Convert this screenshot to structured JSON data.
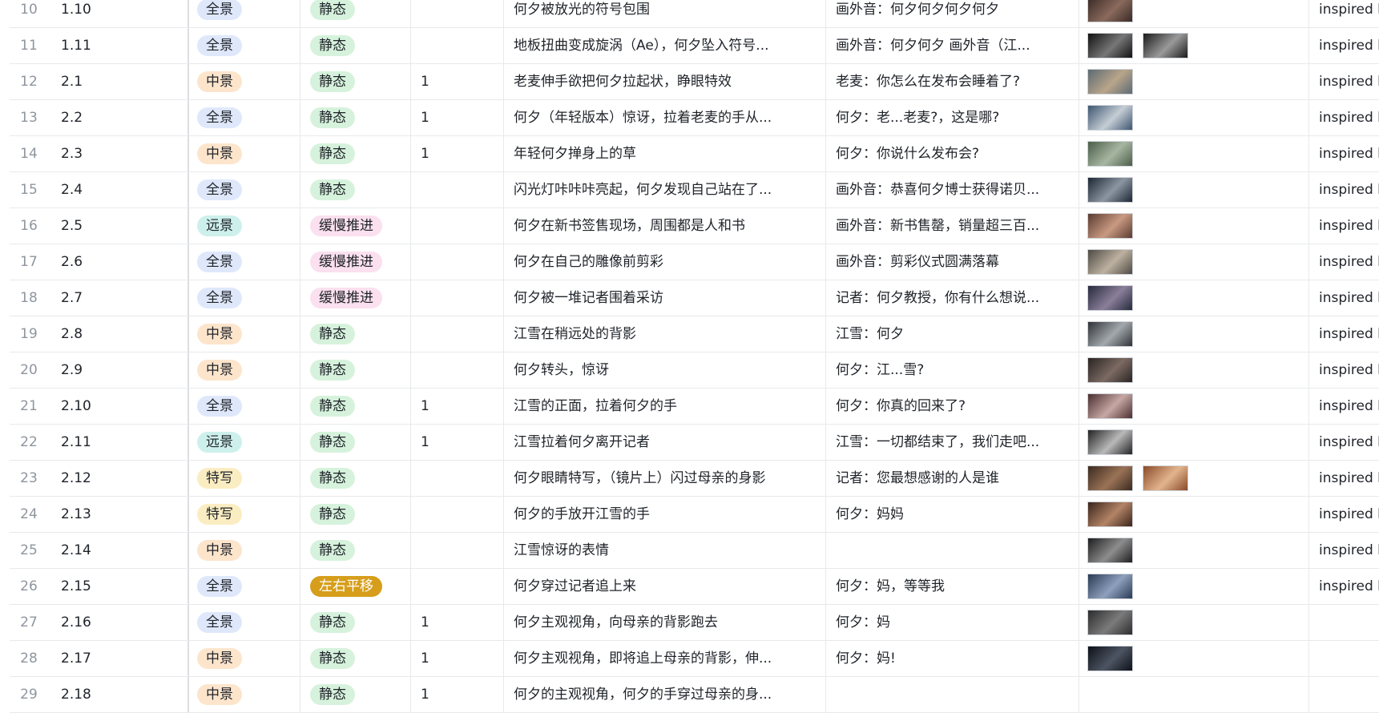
{
  "tag_styles": {
    "全景": {
      "bg": "#dfe8fb",
      "fg": "#1f2329"
    },
    "中景": {
      "bg": "#fde5cc",
      "fg": "#1f2329"
    },
    "远景": {
      "bg": "#cdf0ec",
      "fg": "#1f2329"
    },
    "特写": {
      "bg": "#fbedc2",
      "fg": "#1f2329"
    },
    "静态": {
      "bg": "#d6f2dc",
      "fg": "#1f2329"
    },
    "缓慢推进": {
      "bg": "#fbe0ef",
      "fg": "#1f2329"
    },
    "左右平移": {
      "bg": "#d69e1b",
      "fg": "#ffffff"
    }
  },
  "rows": [
    {
      "idx": "10",
      "num": "1.10",
      "shot": "全景",
      "move": "静态",
      "count": "",
      "desc": "何夕被放光的符号包围",
      "line": "画外音：何夕何夕何夕何夕",
      "thumbs": [
        [
          "#3a2a26",
          "#8a6a5c"
        ]
      ],
      "ref": "inspired by"
    },
    {
      "idx": "11",
      "num": "1.11",
      "shot": "全景",
      "move": "静态",
      "count": "",
      "desc": "地板扭曲变成旋涡（Ae），何夕坠入符号...",
      "line": "画外音：何夕何夕 画外音（江...",
      "thumbs": [
        [
          "#111111",
          "#777777"
        ],
        [
          "#1b1b1b",
          "#9a9a9a"
        ]
      ],
      "ref": "inspired by"
    },
    {
      "idx": "12",
      "num": "2.1",
      "shot": "中景",
      "move": "静态",
      "count": "1",
      "desc": "老麦伸手欲把何夕拉起状，睁眼特效",
      "line": "老麦：你怎么在发布会睡着了?",
      "thumbs": [
        [
          "#5c6a74",
          "#b9a58a"
        ]
      ],
      "ref": "inspired by"
    },
    {
      "idx": "13",
      "num": "2.2",
      "shot": "全景",
      "move": "静态",
      "count": "1",
      "desc": "何夕（年轻版本）惊讶，拉着老麦的手从...",
      "line": "何夕：老...老麦?，这是哪?",
      "thumbs": [
        [
          "#3d5570",
          "#c5cdd5"
        ]
      ],
      "ref": "inspired by"
    },
    {
      "idx": "14",
      "num": "2.3",
      "shot": "中景",
      "move": "静态",
      "count": "1",
      "desc": "年轻何夕掸身上的草",
      "line": "何夕：你说什么发布会?",
      "thumbs": [
        [
          "#4b5e4a",
          "#a7b6a1"
        ]
      ],
      "ref": "inspired by"
    },
    {
      "idx": "15",
      "num": "2.4",
      "shot": "全景",
      "move": "静态",
      "count": "",
      "desc": "闪光灯咔咔咔亮起，何夕发现自己站在了...",
      "line": "画外音：恭喜何夕博士获得诺贝...",
      "thumbs": [
        [
          "#1d2733",
          "#8c96a2"
        ]
      ],
      "ref": "inspired by"
    },
    {
      "idx": "16",
      "num": "2.5",
      "shot": "远景",
      "move": "缓慢推进",
      "count": "",
      "desc": "何夕在新书签售现场，周围都是人和书",
      "line": "画外音：新书售罄，销量超三百...",
      "thumbs": [
        [
          "#5a3b31",
          "#c99a82"
        ]
      ],
      "ref": "inspired by"
    },
    {
      "idx": "17",
      "num": "2.6",
      "shot": "全景",
      "move": "缓慢推进",
      "count": "",
      "desc": "何夕在自己的雕像前剪彩",
      "line": "画外音：剪彩仪式圆满落幕",
      "thumbs": [
        [
          "#4e4a44",
          "#bdb1a0"
        ]
      ],
      "ref": "inspired by"
    },
    {
      "idx": "18",
      "num": "2.7",
      "shot": "全景",
      "move": "缓慢推进",
      "count": "",
      "desc": "何夕被一堆记者围着采访",
      "line": "记者：何夕教授，你有什么想说...",
      "thumbs": [
        [
          "#262a3c",
          "#8b7f9a"
        ]
      ],
      "ref": "inspired by"
    },
    {
      "idx": "19",
      "num": "2.8",
      "shot": "中景",
      "move": "静态",
      "count": "",
      "desc": "江雪在稍远处的背影",
      "line": "江雪：何夕",
      "thumbs": [
        [
          "#2f3338",
          "#a3a8ad"
        ]
      ],
      "ref": "inspired by"
    },
    {
      "idx": "20",
      "num": "2.9",
      "shot": "中景",
      "move": "静态",
      "count": "",
      "desc": "何夕转头，惊讶",
      "line": "何夕：江...雪?",
      "thumbs": [
        [
          "#2a2422",
          "#7c6a63"
        ]
      ],
      "ref": "inspired by"
    },
    {
      "idx": "21",
      "num": "2.10",
      "shot": "全景",
      "move": "静态",
      "count": "1",
      "desc": "江雪的正面，拉着何夕的手",
      "line": "何夕：你真的回来了?",
      "thumbs": [
        [
          "#4a2f2f",
          "#c6a7a4"
        ]
      ],
      "ref": "inspired by"
    },
    {
      "idx": "22",
      "num": "2.11",
      "shot": "远景",
      "move": "静态",
      "count": "1",
      "desc": "江雪拉着何夕离开记者",
      "line": "江雪：一切都结束了，我们走吧...",
      "thumbs": [
        [
          "#222222",
          "#b9b9b9"
        ]
      ],
      "ref": "inspired by"
    },
    {
      "idx": "23",
      "num": "2.12",
      "shot": "特写",
      "move": "静态",
      "count": "",
      "desc": "何夕眼睛特写，（镜片上）闪过母亲的身影",
      "line": "记者：您最想感谢的人是谁",
      "thumbs": [
        [
          "#3b2a20",
          "#9a7356"
        ],
        [
          "#8a4a2a",
          "#e2b48d"
        ]
      ],
      "ref": "inspired by"
    },
    {
      "idx": "24",
      "num": "2.13",
      "shot": "特写",
      "move": "静态",
      "count": "",
      "desc": "何夕的手放开江雪的手",
      "line": "何夕：妈妈",
      "thumbs": [
        [
          "#3a241b",
          "#b38466"
        ]
      ],
      "ref": "inspired by"
    },
    {
      "idx": "25",
      "num": "2.14",
      "shot": "中景",
      "move": "静态",
      "count": "",
      "desc": "江雪惊讶的表情",
      "line": "",
      "thumbs": [
        [
          "#1e1e1e",
          "#8d8d8d"
        ]
      ],
      "ref": "inspired by"
    },
    {
      "idx": "26",
      "num": "2.15",
      "shot": "全景",
      "move": "左右平移",
      "count": "",
      "desc": "何夕穿过记者追上来",
      "line": "何夕：妈，等等我",
      "thumbs": [
        [
          "#2a3a55",
          "#8ea0bd"
        ]
      ],
      "ref": "inspired by"
    },
    {
      "idx": "27",
      "num": "2.16",
      "shot": "全景",
      "move": "静态",
      "count": "1",
      "desc": "何夕主观视角，向母亲的背影跑去",
      "line": "何夕：妈",
      "thumbs": [
        [
          "#2c2c2c",
          "#7b7b7b"
        ]
      ],
      "ref": ""
    },
    {
      "idx": "28",
      "num": "2.17",
      "shot": "中景",
      "move": "静态",
      "count": "1",
      "desc": "何夕主观视角，即将追上母亲的背影，伸...",
      "line": "何夕：妈!",
      "thumbs": [
        [
          "#0d1118",
          "#4d5563"
        ]
      ],
      "ref": ""
    },
    {
      "idx": "29",
      "num": "2.18",
      "shot": "中景",
      "move": "静态",
      "count": "1",
      "desc": "何夕的主观视角，何夕的手穿过母亲的身...",
      "line": "",
      "thumbs": [],
      "ref": ""
    }
  ]
}
